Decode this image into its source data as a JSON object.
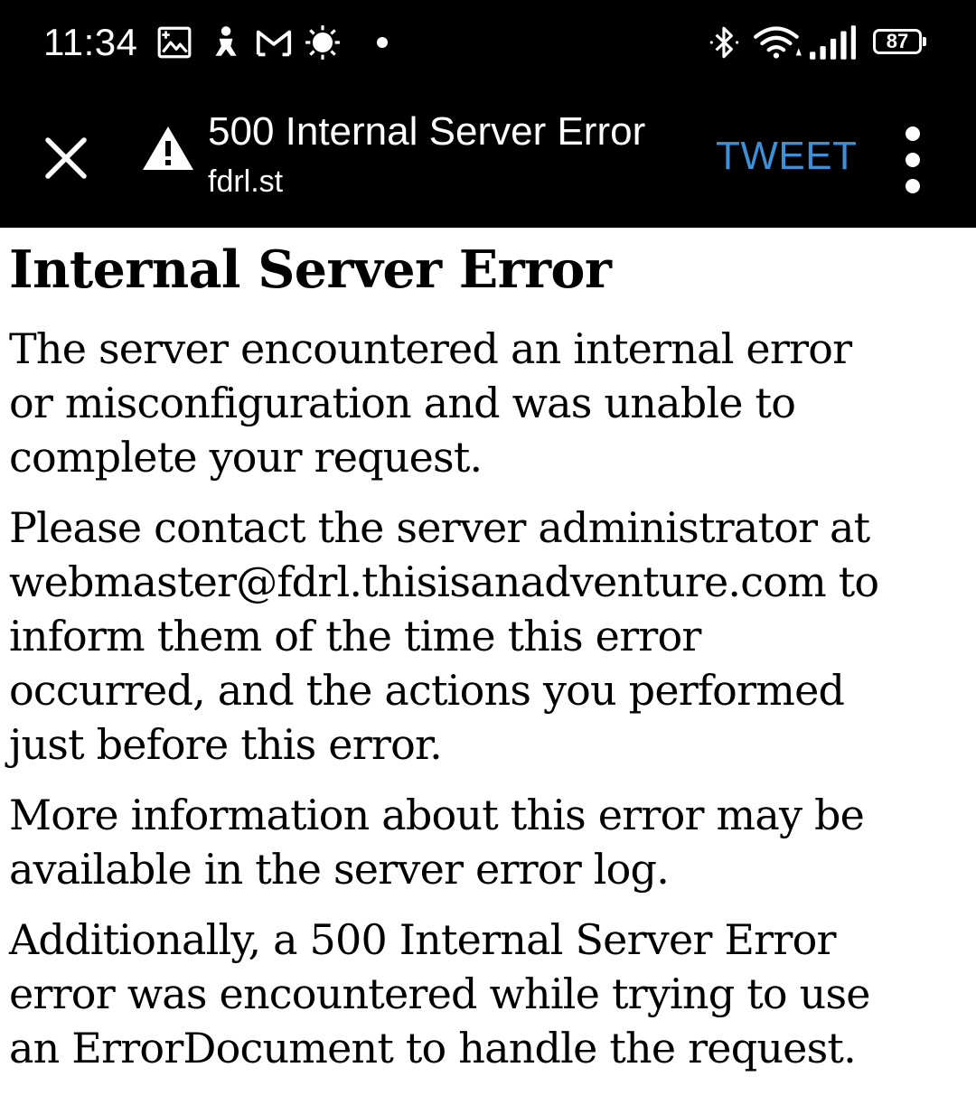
{
  "status_bar": {
    "time": "11:34",
    "notification_icons": [
      "gallery-icon",
      "app-notification-icon",
      "gmail-icon",
      "weather-sun-icon",
      "more-notifications-dot-icon"
    ],
    "system_icons": [
      "bluetooth-icon",
      "wifi-icon",
      "cellular-signal-icon"
    ],
    "battery_level": "87"
  },
  "toolbar": {
    "close_icon": "close-icon",
    "security_icon": "warning-icon",
    "title": "500 Internal Server Error",
    "domain": "fdrl.st",
    "action_label": "TWEET",
    "action_color": "#3d8fd6",
    "menu_icon": "more-vert-icon"
  },
  "page": {
    "heading": "Internal Server Error",
    "paragraphs": [
      {
        "lines": [
          "The server encountered an internal error",
          "or misconfiguration and was unable to",
          "complete your request."
        ]
      },
      {
        "lines": [
          "Please contact the server administrator at",
          "webmaster@fdrl.thisisanadventure.com to",
          "inform them of the time this error",
          "occurred, and the actions you performed",
          "just before this error."
        ]
      },
      {
        "lines": [
          "More information about this error may be",
          "available in the server error log."
        ]
      },
      {
        "lines": [
          "Additionally, a 500 Internal Server Error",
          "error was encountered while trying to use",
          "an ErrorDocument to handle the request."
        ]
      }
    ]
  }
}
